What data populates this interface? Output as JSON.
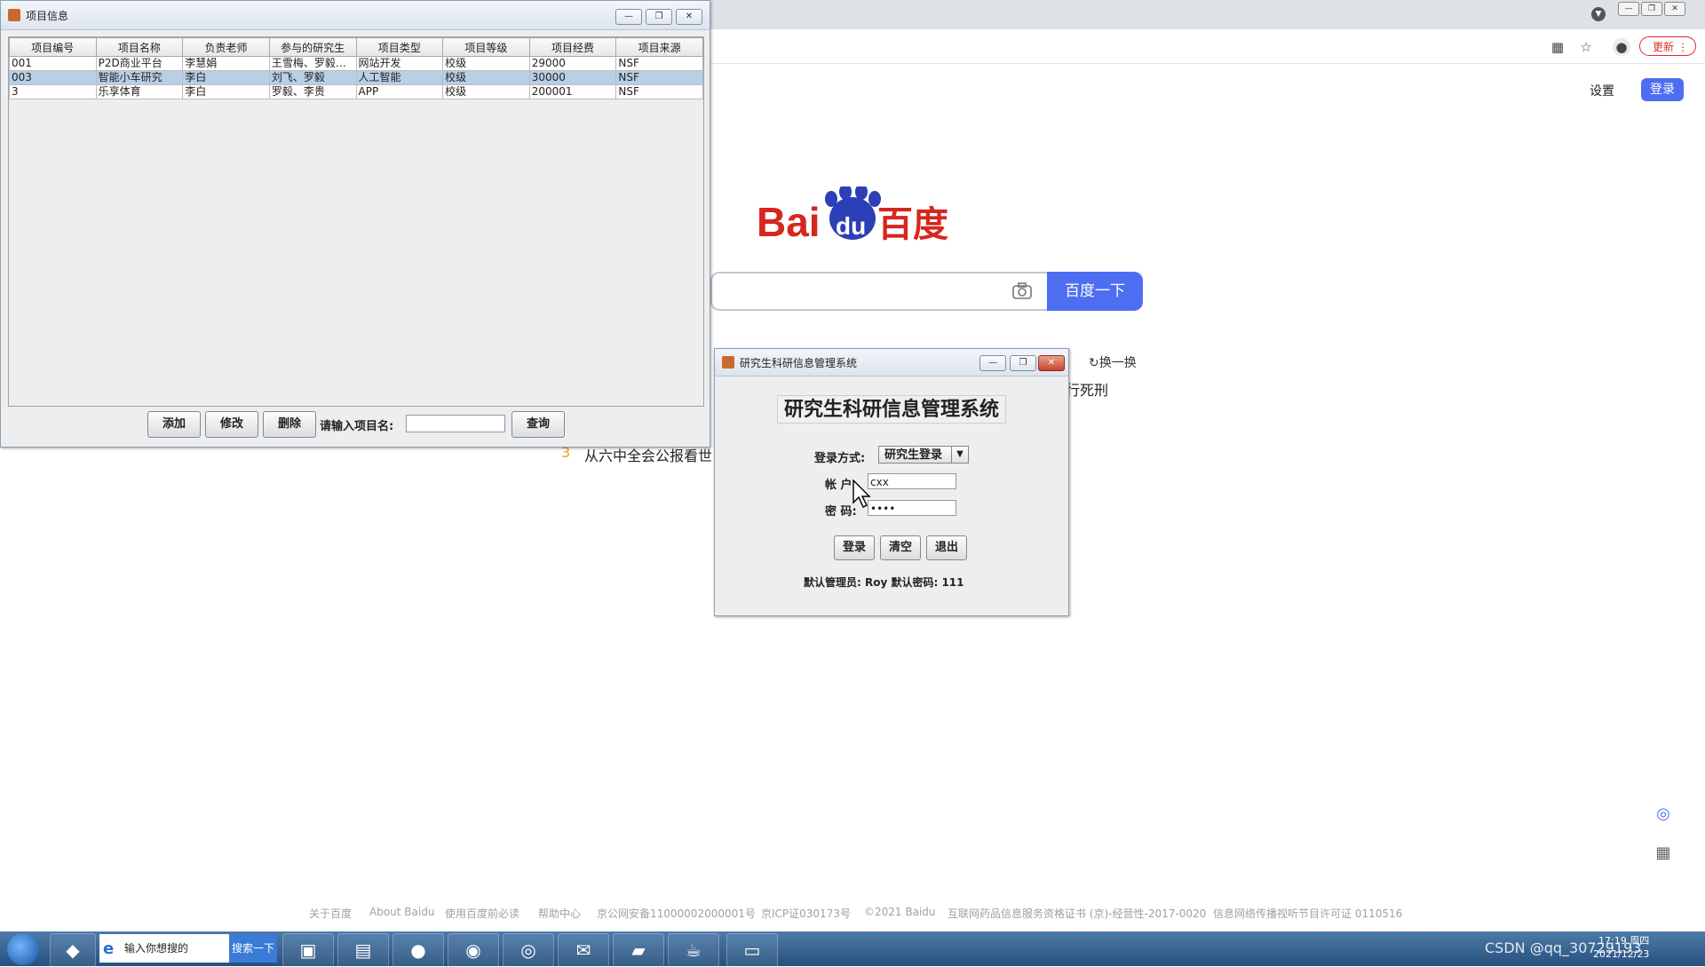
{
  "browser": {
    "update_label": "更新",
    "update_dots": "⋮"
  },
  "baidu": {
    "settings_label": "设置",
    "login_label": "登录",
    "logo_text_bai": "Bai",
    "logo_text_du": "du",
    "logo_text_cn": "百度",
    "search_button": "百度一下",
    "refresh_label": "换一换",
    "hot_fragment": "行死刑",
    "hot_item": {
      "rank": "3",
      "text": "从六中全会公报看世"
    },
    "footer": [
      "关于百度",
      "About Baidu",
      "使用百度前必读",
      "帮助中心",
      "京公网安备11000002000001号",
      "京ICP证030173号",
      "©2021 Baidu",
      "互联网药品信息服务资格证书 (京)-经营性-2017-0020",
      "信息网络传播视听节目许可证 0110516"
    ]
  },
  "project_window": {
    "title": "项目信息",
    "columns": [
      "项目编号",
      "项目名称",
      "负责老师",
      "参与的研究生",
      "项目类型",
      "项目等级",
      "项目经费",
      "项目来源"
    ],
    "rows": [
      [
        "001",
        "P2D商业平台",
        "李慧娟",
        "王雪梅、罗毅、...",
        "网站开发",
        "校级",
        "29000",
        "NSF"
      ],
      [
        "003",
        "智能小车研究",
        "李白",
        "刘飞、罗毅",
        "人工智能",
        "校级",
        "30000",
        "NSF"
      ],
      [
        "3",
        "乐享体育",
        "李白",
        "罗毅、李贵",
        "APP",
        "校级",
        "200001",
        "NSF"
      ]
    ],
    "buttons": {
      "add": "添加",
      "edit": "修改",
      "delete": "删除",
      "query": "查询"
    },
    "search_label": "请输入项目名:",
    "search_value": ""
  },
  "login_window": {
    "title": "研究生科研信息管理系统",
    "heading": "研究生科研信息管理系统",
    "mode_label": "登录方式:",
    "mode_value": "研究生登录",
    "account_label": "帐 户:",
    "account_value": "cxx",
    "password_label": "密 码:",
    "password_value": "••••",
    "buttons": {
      "login": "登录",
      "clear": "清空",
      "exit": "退出"
    },
    "hint": "默认管理员: Roy  默认密码: 111"
  },
  "taskbar": {
    "search_placeholder": "输入你想搜的",
    "search_button": "搜索一下",
    "clock_time": "17:19 周四",
    "clock_date": "2021/12/23",
    "watermark": "CSDN @qq_30729193"
  },
  "colors": {
    "baidu_blue": "#4e6ef2",
    "baidu_red": "#d7261e",
    "selection": "#b8cfe5"
  }
}
